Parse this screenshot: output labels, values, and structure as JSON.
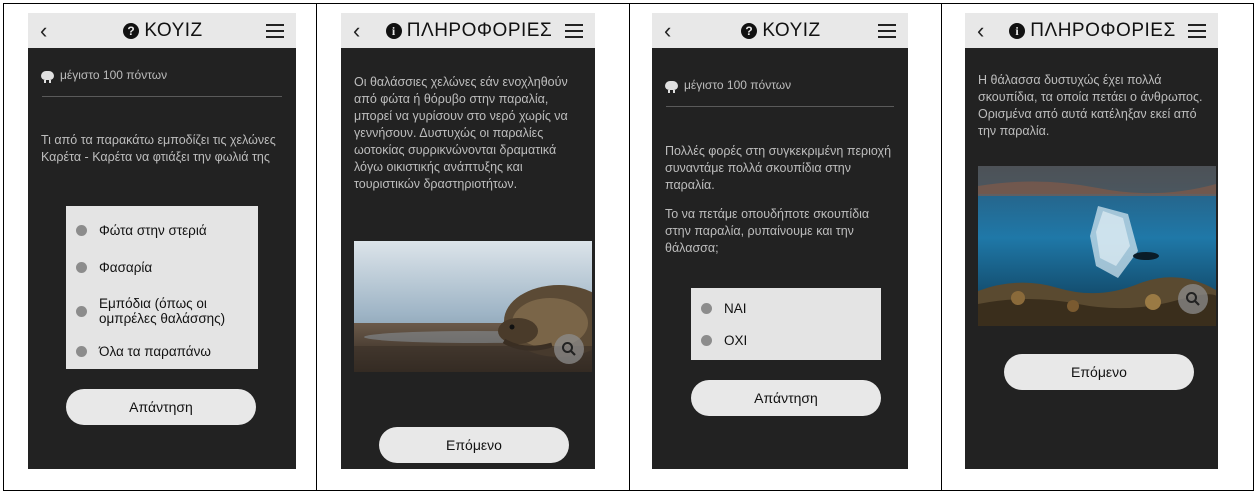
{
  "screens": [
    {
      "title": "ΚΟΥΙΖ",
      "points": "μέγιστο 100 πόντων",
      "question": "Τι από τα παρακάτω εμποδίζει τις χελώνες Καρέτα - Καρέτα να φτιάξει την φωλιά της",
      "options": [
        "Φώτα στην στεριά",
        "Φασαρία",
        "Εμπόδια (όπως οι ομπρέλες θαλάσσης)",
        "Όλα τα παραπάνω"
      ],
      "button": "Απάντηση"
    },
    {
      "title": "ΠΛΗΡΟΦΟΡΙΕΣ",
      "text": "Οι θαλάσσιες χελώνες εάν ενοχληθούν από φώτα ή θόρυβο στην παραλία, μπορεί να γυρίσουν στο νερό χωρίς να γεννήσουν. Δυστυχώς οι παραλίες ωοτοκίας συρρικνώνονται δραματικά λόγω οικιστικής ανάπτυξης και τουριστικών δραστηριοτήτων.",
      "button": "Επόμενο"
    },
    {
      "title": "ΚΟΥΙΖ",
      "points": "μέγιστο 100 πόντων",
      "question1": "Πολλές φορές στη συγκεκριμένη περιοχή συναντάμε πολλά σκουπίδια στην παραλία.",
      "question2": "Το να πετάμε οπουδήποτε σκουπίδια στην παραλία, ρυπαίνουμε και την θάλασσα;",
      "options": [
        "ΝΑΙ",
        "ΟΧΙ"
      ],
      "button": "Απάντηση"
    },
    {
      "title": "ΠΛΗΡΟΦΟΡΙΕΣ",
      "text": "Η θάλασσα δυστυχώς έχει πολλά σκουπίδια, τα οποία πετάει ο άνθρωπος. Ορισμένα από αυτά κατέληξαν εκεί από την παραλία.",
      "button": "Επόμενο"
    }
  ],
  "icons": {
    "back": "‹",
    "quiz_badge": "?",
    "info_badge": "i",
    "menu": "hamburger-menu",
    "zoom": "magnifier",
    "points": "piggy-bank"
  },
  "colors": {
    "screen_bg": "#222222",
    "bar_bg": "#e8e8e8",
    "text": "#bdbdbd"
  }
}
